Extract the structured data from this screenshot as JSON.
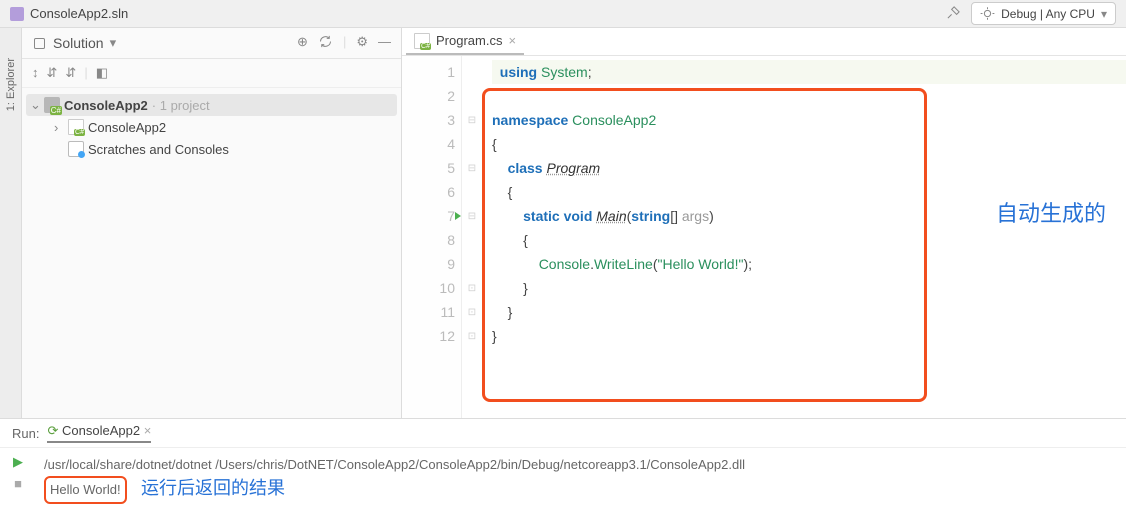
{
  "topbar": {
    "sln_file": "ConsoleApp2.sln",
    "run_config": "Debug | Any CPU"
  },
  "sidebar": {
    "title": "Solution",
    "tree": {
      "root_name": "ConsoleApp2",
      "root_suffix": " · 1 project",
      "proj_name": "ConsoleApp2",
      "scratches": "Scratches and Consoles"
    }
  },
  "editor": {
    "file_tab": "Program.cs",
    "lines": [
      "1",
      "2",
      "3",
      "4",
      "5",
      "6",
      "7",
      "8",
      "9",
      "10",
      "11",
      "12"
    ],
    "code": {
      "l1_kw": "using ",
      "l1_typ": "System",
      "l1_p": ";",
      "l3_kw": "namespace ",
      "l3_typ": "ConsoleApp2",
      "l4": "{",
      "l5_kw": "class ",
      "l5_cls": "Program",
      "l6": "{",
      "l7_kw1": "static ",
      "l7_kw2": "void ",
      "l7_fn": "Main",
      "l7_p1": "(",
      "l7_typ": "string",
      "l7_arr": "[] ",
      "l7_arg": "args",
      "l7_p2": ")",
      "l8": "{",
      "l9_a": "Console",
      "l9_b": ".",
      "l9_c": "WriteLine",
      "l9_d": "(",
      "l9_str": "\"Hello World!\"",
      "l9_e": ");",
      "l10": "}",
      "l11": "}",
      "l12": "}"
    }
  },
  "annotations": {
    "auto_gen": "自动生成的",
    "result_label": "运行后返回的结果"
  },
  "run": {
    "title": "Run:",
    "tab": "ConsoleApp2",
    "cmd": "/usr/local/share/dotnet/dotnet /Users/chris/DotNET/ConsoleApp2/ConsoleApp2/bin/Debug/netcoreapp3.1/ConsoleApp2.dll",
    "output": "Hello World!"
  }
}
